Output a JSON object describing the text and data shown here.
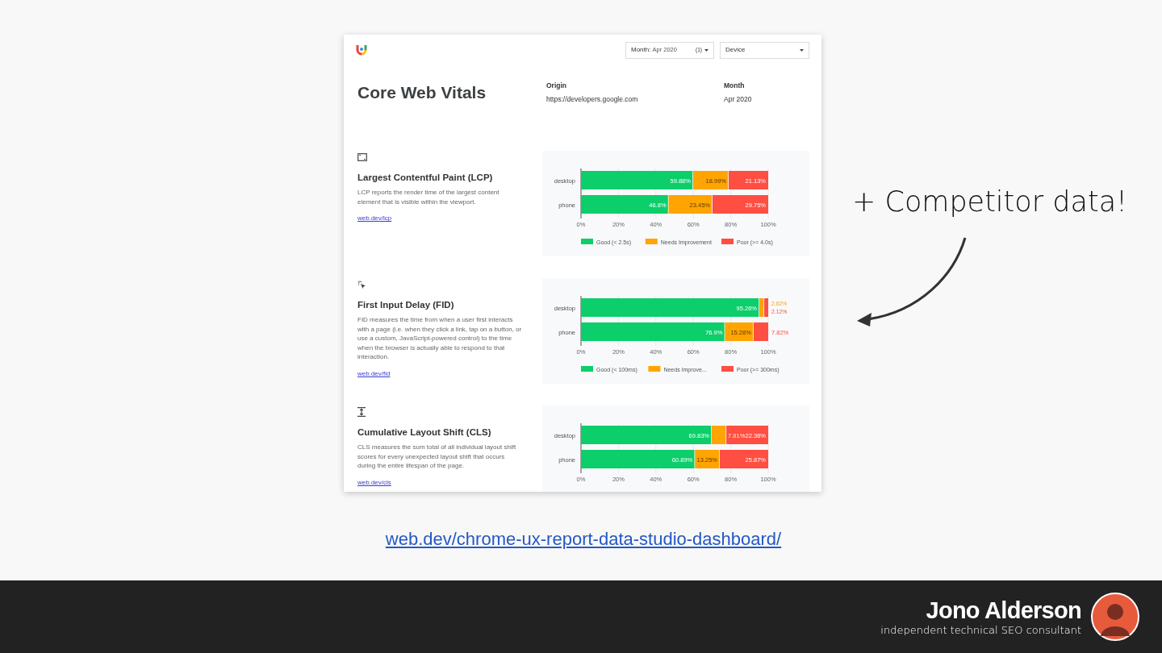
{
  "dashboard": {
    "filters": [
      {
        "label": "Month:",
        "value": "Apr 2020",
        "count": "(1)"
      },
      {
        "label": "Device"
      }
    ],
    "title": "Core Web Vitals",
    "fields": [
      {
        "label": "Origin",
        "value": "https://developers.google.com"
      },
      {
        "label": "Month",
        "value": "Apr 2020"
      }
    ],
    "metrics": [
      {
        "kind": "frame",
        "title": "Largest Contentful Paint (LCP)",
        "description": "LCP reports the render time of the largest content element that is visible within the viewport.",
        "link": "web.dev/lcp",
        "chart_data": {
          "type": "bar",
          "orientation": "horizontal",
          "stacked": true,
          "grid": true,
          "legend": true,
          "categories": [
            "desktop",
            "phone"
          ],
          "xlim": [
            0,
            100
          ],
          "xticks": [
            {
              "value": 0,
              "label": "0%"
            },
            {
              "value": 20,
              "label": "20%"
            },
            {
              "value": 40,
              "label": "40%"
            },
            {
              "value": 60,
              "label": "60%"
            },
            {
              "value": 80,
              "label": "80%"
            },
            {
              "value": 100,
              "label": "100%"
            }
          ],
          "series": [
            {
              "name": "Good (< 2.5s)",
              "color": "#0cce6b",
              "values": [
                59.88,
                46.8
              ],
              "value_labels": [
                "59.88%",
                "46.8%"
              ]
            },
            {
              "name": "Needs Improvement",
              "color": "#ffa400",
              "values": [
                18.99,
                23.45
              ],
              "value_labels": [
                "18.99%",
                "23.45%"
              ]
            },
            {
              "name": "Poor (>= 4.0s)",
              "color": "#ff4e42",
              "values": [
                21.13,
                29.75
              ],
              "value_labels": [
                "21.13%",
                "29.75%"
              ]
            }
          ]
        }
      },
      {
        "kind": "cursor",
        "title": "First Input Delay (FID)",
        "description": "FID measures the time from when a user first interacts with a page (i.e. when they click a link, tap on a button, or use a custom, JavaScript-powered control) to the time when the browser is actually able to respond to that interaction.",
        "link": "web.dev/fid",
        "chart_data": {
          "type": "bar",
          "orientation": "horizontal",
          "stacked": true,
          "grid": true,
          "legend": true,
          "categories": [
            "desktop",
            "phone"
          ],
          "xlim": [
            0,
            100
          ],
          "xticks": [
            {
              "value": 0,
              "label": "0%"
            },
            {
              "value": 20,
              "label": "20%"
            },
            {
              "value": 40,
              "label": "40%"
            },
            {
              "value": 60,
              "label": "60%"
            },
            {
              "value": 80,
              "label": "80%"
            },
            {
              "value": 100,
              "label": "100%"
            }
          ],
          "series": [
            {
              "name": "Good (< 100ms)",
              "color": "#0cce6b",
              "values": [
                95.26,
                76.9
              ],
              "value_labels": [
                "95.26%",
                "76.9%"
              ]
            },
            {
              "name": "Needs Improve...",
              "color": "#ffa400",
              "values": [
                2.62,
                15.28
              ],
              "value_labels": [
                "2.62%",
                "15.28%"
              ]
            },
            {
              "name": "Poor (>= 300ms)",
              "color": "#ff4e42",
              "values": [
                2.12,
                7.82
              ],
              "value_labels": [
                "2.12%",
                "7.82%"
              ]
            }
          ]
        }
      },
      {
        "kind": "shift",
        "title": "Cumulative Layout Shift (CLS)",
        "description": "CLS measures the sum total of all individual layout shift scores for every unexpected layout shift that occurs during the entire lifespan of the page.",
        "link": "web.dev/cls",
        "chart_data": {
          "type": "bar",
          "orientation": "horizontal",
          "stacked": true,
          "grid": true,
          "categories": [
            "desktop",
            "phone"
          ],
          "xlim": [
            0,
            100
          ],
          "xticks": [
            {
              "value": 0,
              "label": "0%"
            },
            {
              "value": 20,
              "label": "20%"
            },
            {
              "value": 40,
              "label": "40%"
            },
            {
              "value": 60,
              "label": "60%"
            },
            {
              "value": 80,
              "label": "80%"
            },
            {
              "value": 100,
              "label": "100%"
            }
          ],
          "series": [
            {
              "color": "#0cce6b",
              "values": [
                69.83,
                60.89
              ],
              "value_labels": [
                "69.83%",
                "60.89%"
              ]
            },
            {
              "color": "#ffa400",
              "values": [
                7.81,
                13.25
              ],
              "value_labels": [
                "7.81%",
                "13.25%"
              ]
            },
            {
              "color": "#ff4e42",
              "values": [
                22.36,
                25.87
              ],
              "value_labels": [
                "22.36%",
                "25.87%"
              ]
            }
          ]
        }
      }
    ]
  },
  "link": "web.dev/chrome-ux-report-data-studio-dashboard/",
  "annotation": "+ Competitor data!",
  "footer": {
    "name": "Jono Alderson",
    "tagline": "independent technical SEO consultant"
  }
}
